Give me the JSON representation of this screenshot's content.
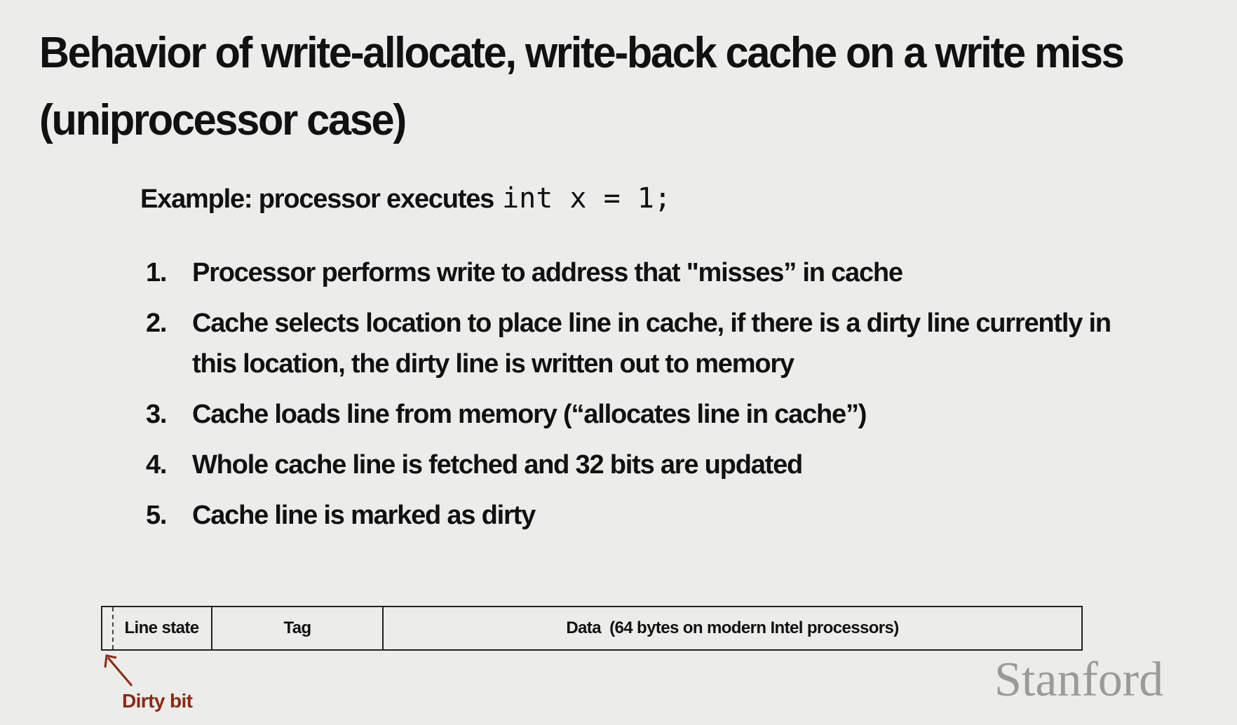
{
  "slide": {
    "title": "Behavior of write-allocate, write-back cache on a write miss (uniprocessor case)",
    "example_label": "Example: processor executes",
    "example_code": "int x = 1;",
    "steps": [
      {
        "number": "1.",
        "text": "Processor performs write to address that \"misses” in cache"
      },
      {
        "number": "2.",
        "text": "Cache selects location to place line in cache, if there is a dirty line currently in this location, the dirty line is written out to memory"
      },
      {
        "number": "3.",
        "text": "Cache loads line from memory (“allocates line in cache”)"
      },
      {
        "number": "4.",
        "text": "Whole cache line is fetched and 32 bits are updated"
      },
      {
        "number": "5.",
        "text": "Cache line is marked as dirty"
      }
    ],
    "cache_line": {
      "line_state": "Line state",
      "tag": "Tag",
      "data": "Data  (64 bytes on modern Intel processors)"
    },
    "dirty_bit_label": "Dirty bit",
    "logo": "Stanford",
    "colors": {
      "background": "#ececea",
      "annotation": "#8a2a10",
      "logo": "#9a9a98"
    }
  }
}
